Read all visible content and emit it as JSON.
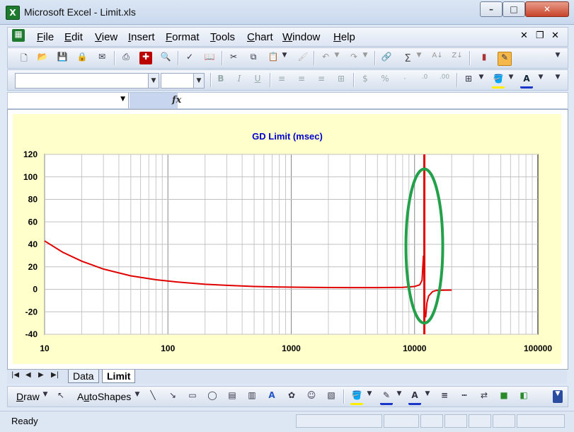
{
  "window": {
    "title": "Microsoft Excel - Limit.xls",
    "app_icon": "X"
  },
  "menu": {
    "items": [
      "File",
      "Edit",
      "View",
      "Insert",
      "Format",
      "Tools",
      "Chart",
      "Window",
      "Help"
    ]
  },
  "formula_bar": {
    "fx": "fx"
  },
  "chart_data": {
    "type": "line",
    "title": "GD Limit (msec)",
    "x_scale": "log",
    "xlim": [
      10,
      100000
    ],
    "ylim": [
      -40,
      120
    ],
    "x_ticks": [
      "10",
      "100",
      "1000",
      "10000",
      "100000"
    ],
    "y_ticks": [
      "-40",
      "-20",
      "0",
      "20",
      "40",
      "60",
      "80",
      "100",
      "120"
    ],
    "grid": true,
    "colors": {
      "series": "#e00000",
      "vline": "#e00000",
      "annotation": "#22a04a",
      "plot_bg": "#ffffff",
      "chart_bg": "#ffffcc",
      "title": "#0000cc"
    },
    "series": [
      {
        "x": [
          10,
          14,
          20,
          30,
          50,
          80,
          120,
          200,
          300,
          500,
          800,
          1200,
          2000,
          3000,
          5000,
          8000,
          10000,
          11000,
          11500,
          11800
        ],
        "y": [
          43,
          33,
          25,
          18,
          12,
          8.5,
          6.5,
          4.5,
          3.5,
          2.5,
          2,
          1.8,
          1.6,
          1.5,
          1.5,
          1.7,
          2.5,
          4,
          8,
          30
        ]
      },
      {
        "x": [
          12300,
          12600,
          13000,
          14000,
          15000,
          17000,
          20000
        ],
        "y": [
          -25,
          -12,
          -6,
          -2,
          -1,
          -0.8,
          -0.7
        ]
      }
    ],
    "vline_x": 12000,
    "annotation": {
      "shape": "ellipse",
      "cx": 12000,
      "cy": 38,
      "y_top": 107,
      "y_bottom": -30
    }
  },
  "sheet_tabs": {
    "tabs": [
      "Data",
      "Limit"
    ],
    "active": "Limit"
  },
  "draw_toolbar": {
    "draw": "Draw",
    "autoshapes": "AutoShapes"
  },
  "status": {
    "text": "Ready"
  }
}
